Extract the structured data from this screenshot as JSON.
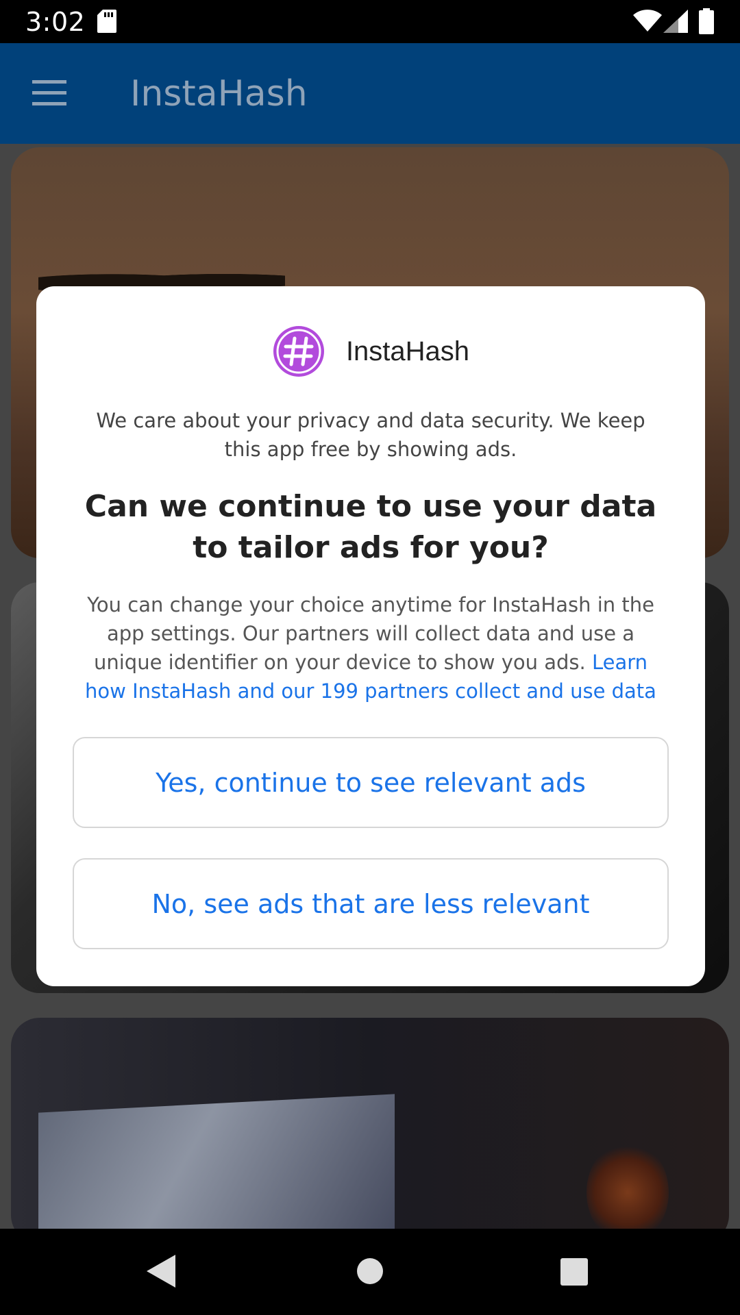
{
  "status_bar": {
    "time": "3:02",
    "icons": [
      "sd-card-icon",
      "wifi-icon",
      "signal-icon",
      "battery-icon"
    ]
  },
  "app_bar": {
    "title": "InstaHash",
    "menu_icon": "menu-icon"
  },
  "dialog": {
    "brand_name": "InstaHash",
    "brand_logo_icon": "hash-logo-icon",
    "intro": "We care about your privacy and data security. We keep this app free by showing ads.",
    "question": "Can we continue to use your data to tailor ads for you?",
    "details": "You can change your choice anytime for InstaHash in the app settings. Our partners will collect data and use a unique identifier on your device to show you ads. ",
    "learn_link": "Learn how InstaHash and our 199 partners collect and use data",
    "yes_button": "Yes, continue to see relevant ads",
    "no_button": "No, see ads that are less relevant"
  },
  "colors": {
    "app_bar": "#01417a",
    "link": "#1a73e8",
    "logo": "#b24bdc"
  },
  "nav_bar": {
    "icons": [
      "back-icon",
      "home-icon",
      "recents-icon"
    ]
  }
}
